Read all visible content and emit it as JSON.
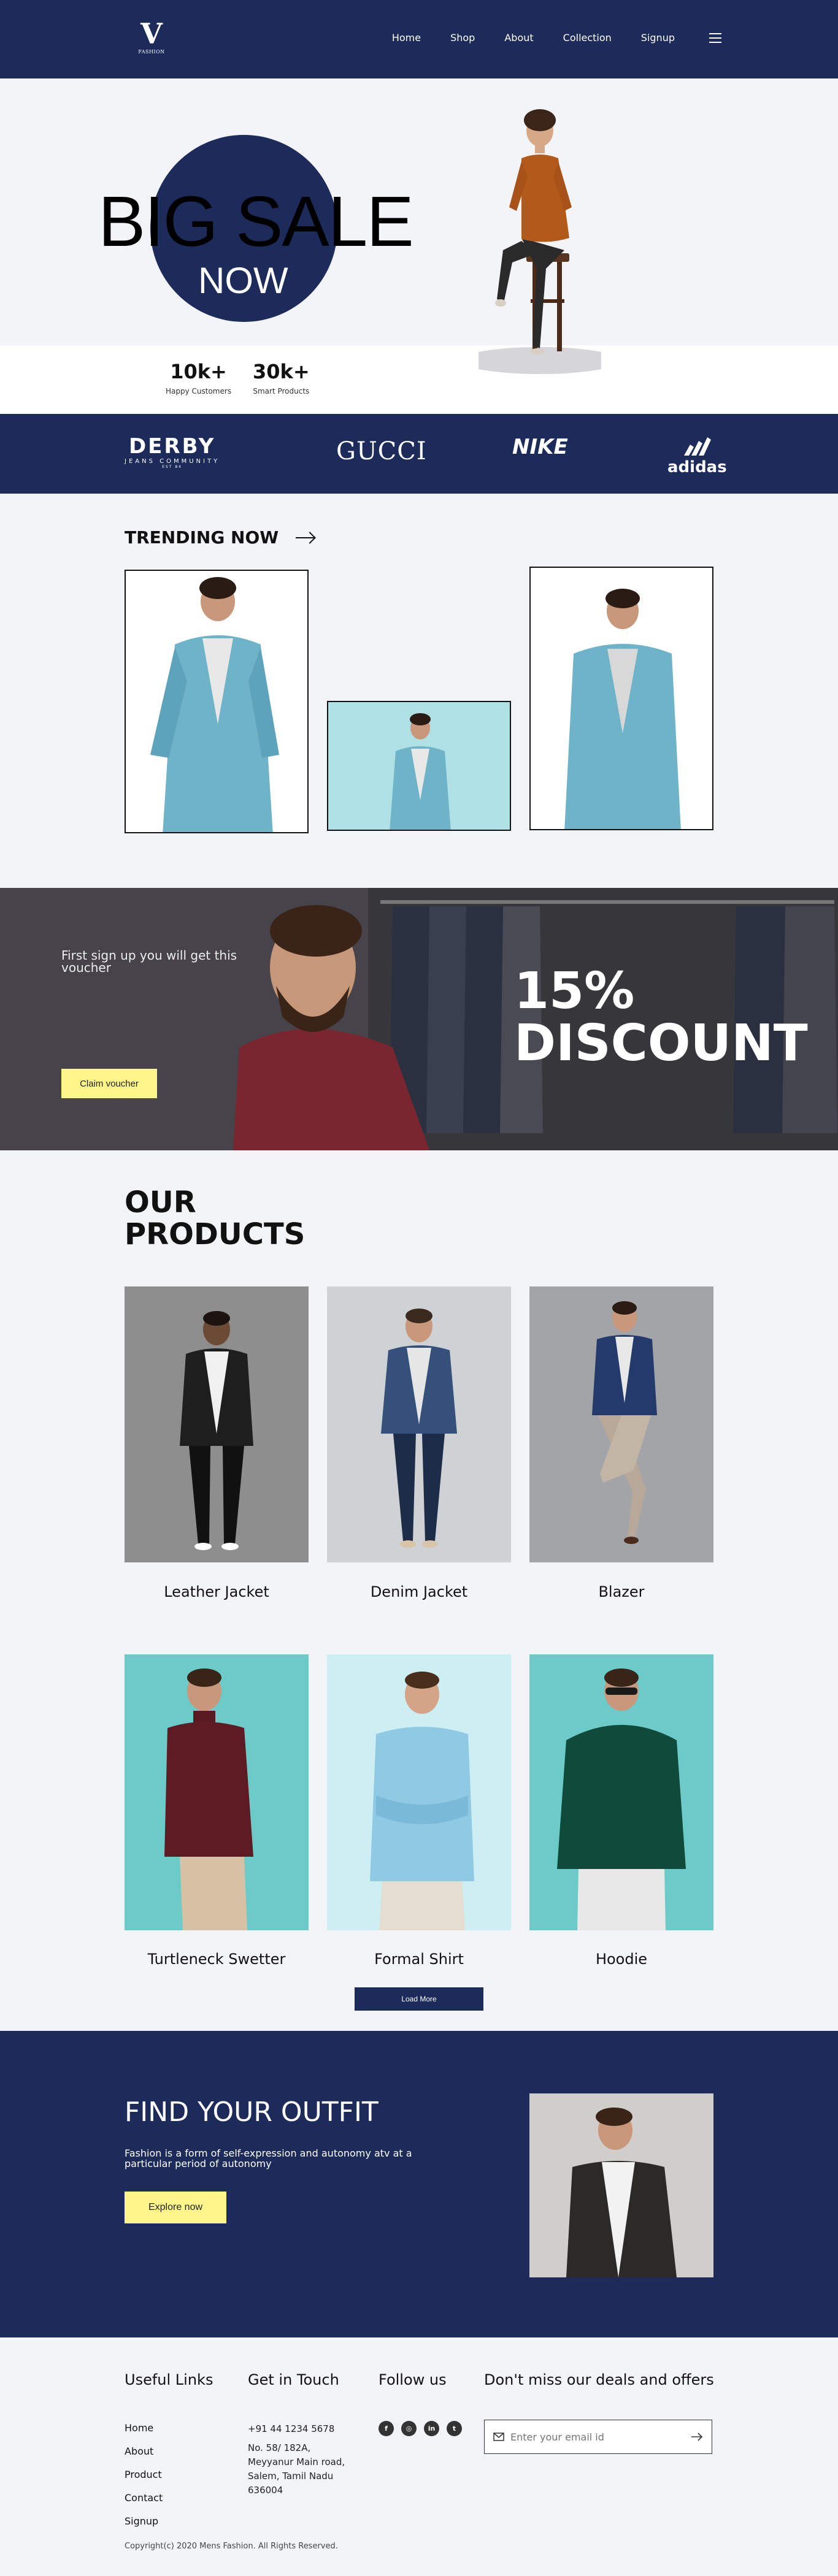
{
  "nav": {
    "logo_mark": "V",
    "logo_sub": "FASHION",
    "links": [
      "Home",
      "Shop",
      "About",
      "Collection",
      "Signup"
    ]
  },
  "hero": {
    "title_line1": "BIG SALE",
    "title_line2": "NOW",
    "stats": [
      {
        "value": "10k+",
        "label": "Happy Customers"
      },
      {
        "value": "30k+",
        "label": "Smart Products"
      }
    ]
  },
  "brands": {
    "derby": {
      "name": "DERBY",
      "line2": "JEANS COMMUNITY",
      "line3": "EST 84"
    },
    "gucci": "GUCCI",
    "nike": "NIKE",
    "adidas": "adidas"
  },
  "trending": {
    "title": "TRENDING NOW"
  },
  "discount": {
    "text": "First sign up you will get this voucher",
    "button": "Claim voucher",
    "big_line1": "15%",
    "big_line2": "DISCOUNT"
  },
  "products": {
    "title_line1": "OUR",
    "title_line2": "PRODUCTS",
    "items": [
      {
        "name": "Leather Jacket"
      },
      {
        "name": "Denim Jacket"
      },
      {
        "name": "Blazer"
      },
      {
        "name": "Turtleneck Swetter"
      },
      {
        "name": "Formal Shirt"
      },
      {
        "name": "Hoodie"
      }
    ],
    "load_more": "Load More"
  },
  "outfit": {
    "title": "FIND YOUR OUTFIT",
    "text": "Fashion is a form of self-expression and autonomy atv at a particular period of autonomy",
    "button": "Explore now"
  },
  "footer": {
    "useful_links_title": "Useful Links",
    "useful_links": [
      "Home",
      "About",
      "Product",
      "Contact",
      "Signup"
    ],
    "touch_title": "Get in Touch",
    "phone": "+91 44 1234 5678",
    "address": "No. 58/ 182A,\nMeyyanur Main road,\nSalem, Tamil Nadu\n636004",
    "follow_title": "Follow us",
    "deals_title": "Don't miss our deals and offers",
    "email_placeholder": "Enter your email id",
    "copyright": "Copyright(c) 2020 Mens Fashion. All Rights Reserved."
  },
  "colors": {
    "navy": "#1c2b5a",
    "accent_yellow": "#fef68a",
    "background": "#f3f4f8"
  }
}
